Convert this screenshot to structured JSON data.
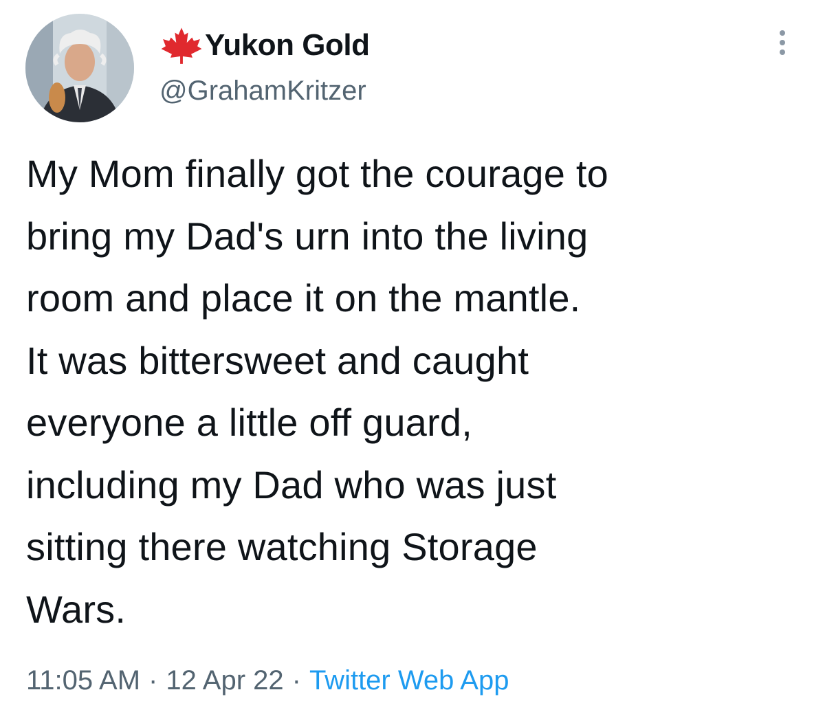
{
  "tweet": {
    "author": {
      "display_name": "Yukon Gold",
      "handle": "@GrahamKritzer",
      "name_icon": "maple-leaf-icon",
      "avatar": "avatar-photo"
    },
    "more_icon": "more-options-icon",
    "text_lines": [
      "My Mom finally got the courage to",
      "bring my Dad's urn into the living",
      "room and place it on the mantle.",
      "It was bittersweet and caught",
      "everyone a little off guard,",
      "including my Dad who was just",
      "sitting there watching Storage",
      "Wars."
    ],
    "meta": {
      "time": "11:05 AM",
      "separator": "·",
      "date": "12 Apr 22",
      "source": "Twitter Web App"
    },
    "colors": {
      "text": "#0f1419",
      "secondary": "#536471",
      "link": "#1d9bf0",
      "maple_leaf": "#e0292e"
    }
  }
}
